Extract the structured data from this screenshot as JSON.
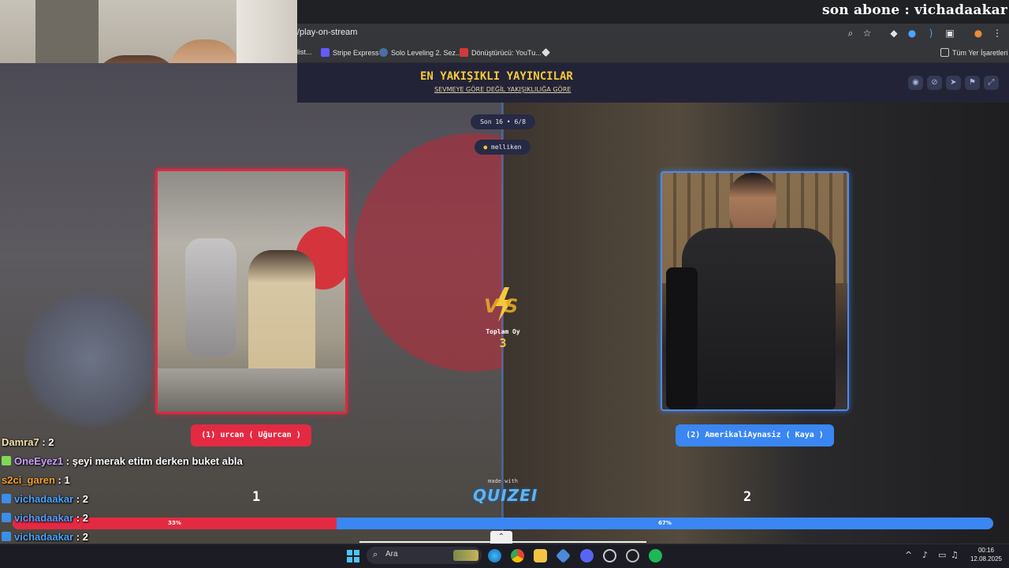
{
  "stream_overlay": {
    "subscriber_text": "son abone : vichadaakar"
  },
  "browser": {
    "url": "/play-on-stream",
    "bookmarks": [
      {
        "label": "list..."
      },
      {
        "label": "Stripe Express"
      },
      {
        "label": "Solo Leveling 2. Sez..."
      },
      {
        "label": "Dönüştürücü: YouTu..."
      },
      {
        "label": "Tüm Yer İşaretleri"
      }
    ]
  },
  "app": {
    "title": "EN YAKIŞIKLI YAYINCILAR",
    "subtitle": "SEVMEYE GÖRE DEĞİL YAKIŞIKLILIĞA GÖRE",
    "round": "Son 16 • 6/8",
    "user": "melliken",
    "total_votes_label": "Toplam Oy",
    "total_votes": "3",
    "made_with": "made with",
    "brand": "QUIZEI"
  },
  "contestants": {
    "left": {
      "name": "(1) urcan ( Uğurcan )",
      "score": "1",
      "percent_label": "33%",
      "share": 0.33
    },
    "right": {
      "name": "(2) AmerikaliAynasiz ( Kaya )",
      "score": "2",
      "percent_label": "67%",
      "share": 0.67
    }
  },
  "chat": [
    {
      "user": "Damra7",
      "message": " : 2",
      "color": "#f4e3a8",
      "badge": ""
    },
    {
      "user": "OneEyez1",
      "message": " : şeyi merak etitm derken buket abla",
      "color": "#c9a0ff",
      "badge": "#7ed957"
    },
    {
      "user": "s2ci_garen",
      "message": " : 1",
      "color": "#f0a030",
      "badge": ""
    },
    {
      "user": "vichadaakar",
      "message": " : 2",
      "color": "#4aa3ff",
      "badge": "#3b8eea"
    },
    {
      "user": "vichadaakar",
      "message": " : 2",
      "color": "#4aa3ff",
      "badge": "#3b8eea"
    },
    {
      "user": "vichadaakar",
      "message": " : 2",
      "color": "#4aa3ff",
      "badge": "#3b8eea"
    },
    {
      "user": "vichadaakar",
      "message": " : 2",
      "color": "#4aa3ff",
      "badge": "#3b8eea"
    }
  ],
  "taskbar": {
    "search_placeholder": "Ara",
    "time": "00:16",
    "date": "12.08.2025"
  },
  "colors": {
    "accent_red": "#e42a42",
    "accent_blue": "#3a86f2",
    "title_gold": "#f5c93b"
  }
}
